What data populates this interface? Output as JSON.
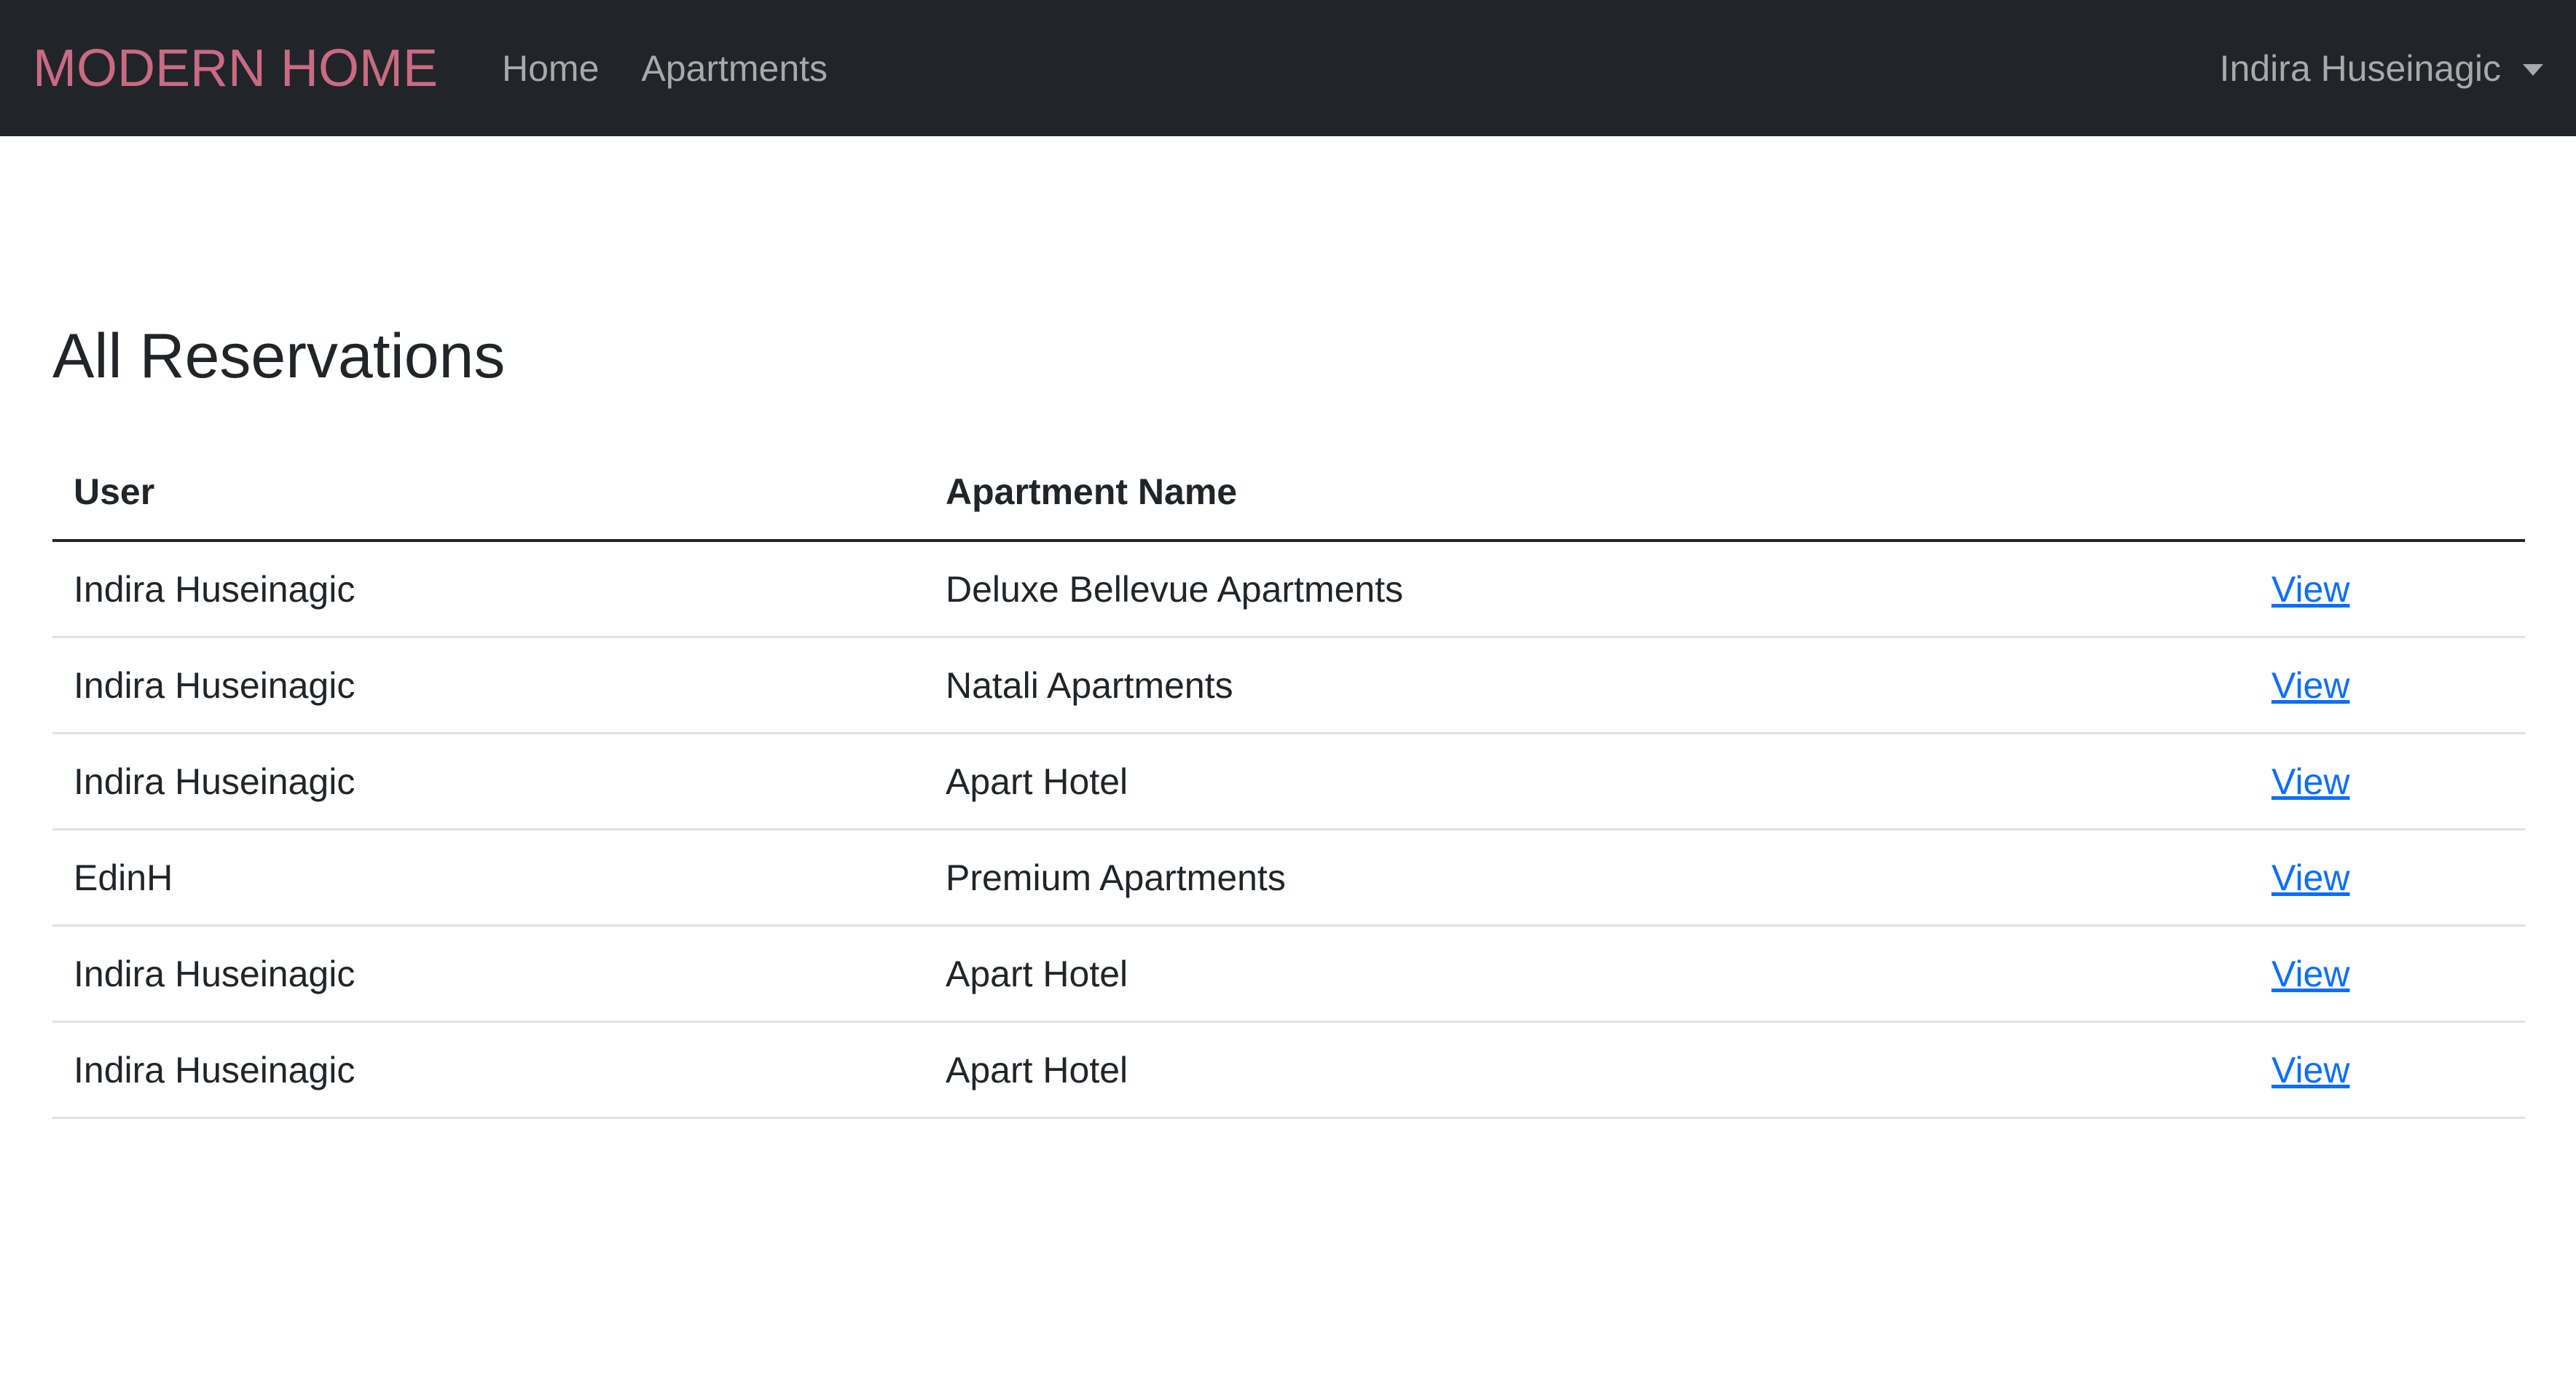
{
  "navbar": {
    "brand": "MODERN HOME",
    "links": [
      {
        "label": "Home"
      },
      {
        "label": "Apartments"
      }
    ],
    "user_name": "Indira Huseinagic"
  },
  "page": {
    "title": "All Reservations"
  },
  "table": {
    "headers": [
      "User",
      "Apartment Name",
      ""
    ],
    "rows": [
      {
        "user": "Indira Huseinagic",
        "apartment": "Deluxe Bellevue Apartments",
        "action": "View"
      },
      {
        "user": "Indira Huseinagic",
        "apartment": "Natali Apartments",
        "action": "View"
      },
      {
        "user": "Indira Huseinagic",
        "apartment": "Apart Hotel",
        "action": "View"
      },
      {
        "user": "EdinH",
        "apartment": "Premium Apartments",
        "action": "View"
      },
      {
        "user": "Indira Huseinagic",
        "apartment": "Apart Hotel",
        "action": "View"
      },
      {
        "user": "Indira Huseinagic",
        "apartment": "Apart Hotel",
        "action": "View"
      }
    ]
  },
  "colors": {
    "navbar_bg": "#212529",
    "brand": "#c96b82",
    "nav_text": "#a7a9ab",
    "link": "#0d6efd"
  },
  "icons": {
    "user_menu_caret": "chevron-down-icon"
  }
}
